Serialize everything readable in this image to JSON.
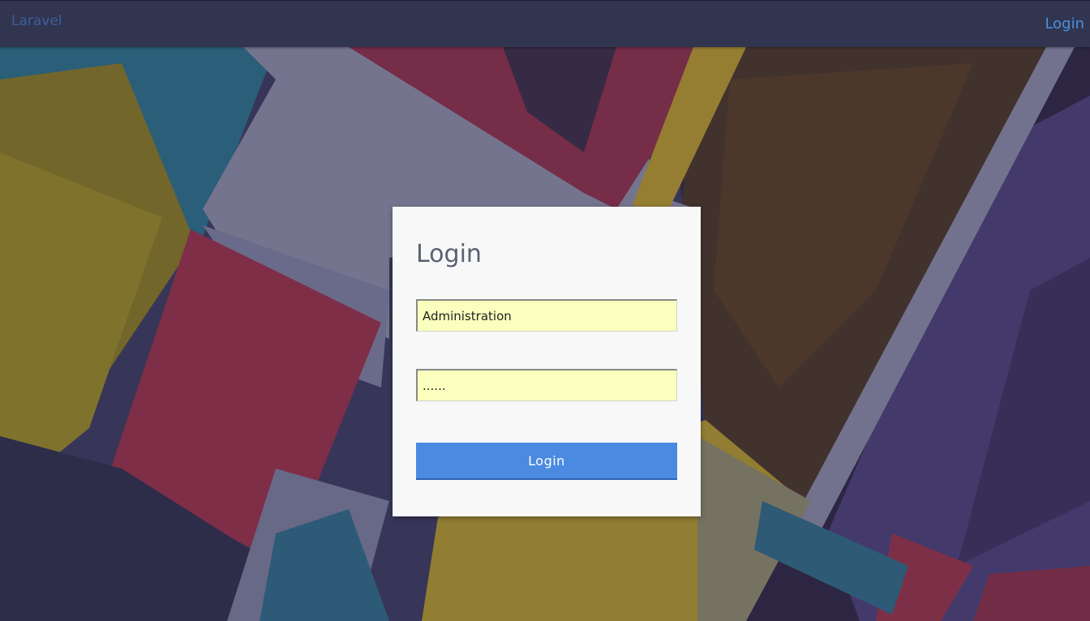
{
  "navbar": {
    "brand": "Laravel",
    "login_link": "Login"
  },
  "login_form": {
    "title": "Login",
    "username_value": "Administration",
    "password_value": "......",
    "submit_label": "Login"
  },
  "colors": {
    "navbar_bg": "#31354f",
    "link": "#4a90e2",
    "button": "#4a8ae0",
    "autofill": "#faffbd",
    "card": "#f8f8f8"
  }
}
